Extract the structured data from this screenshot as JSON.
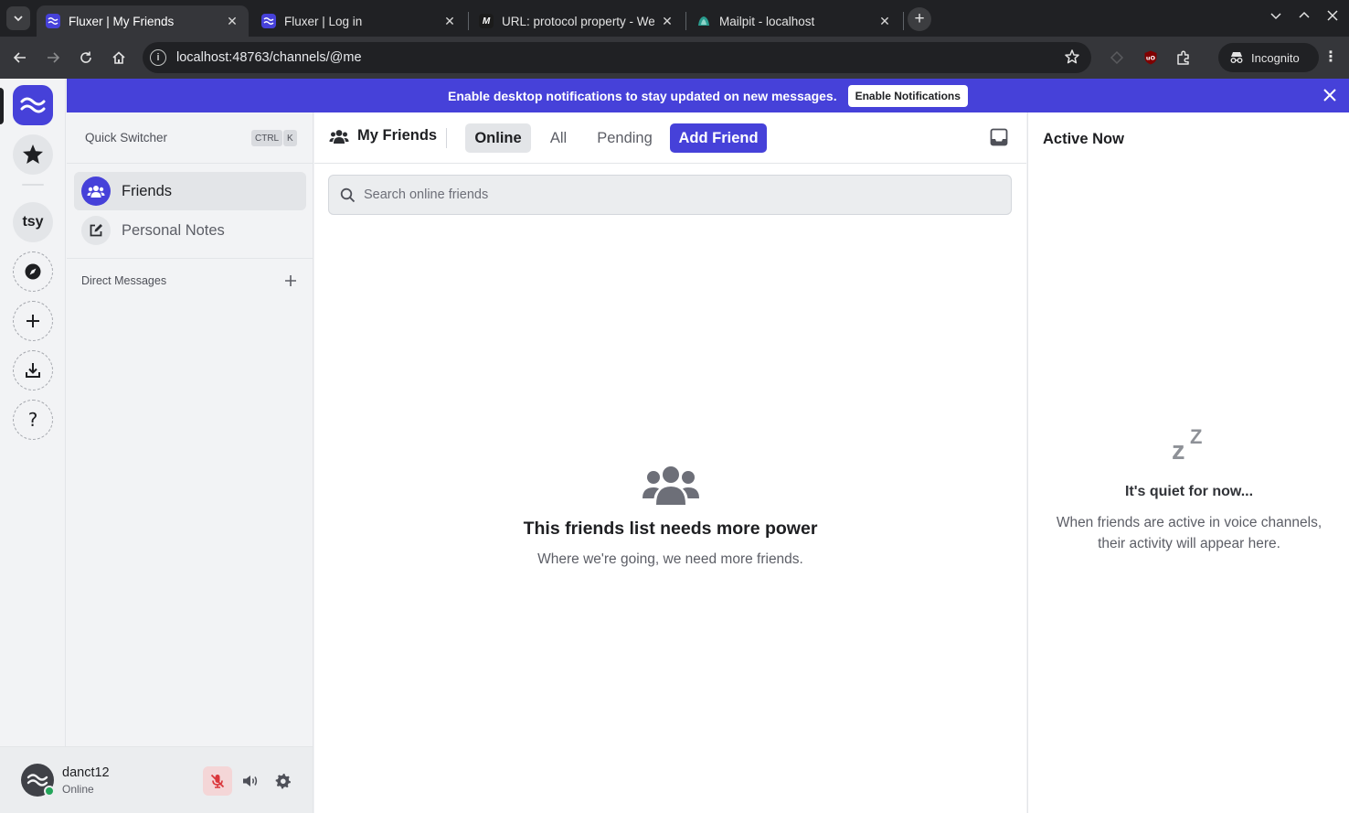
{
  "browser": {
    "tabs": [
      {
        "title": "Fluxer | My Friends",
        "active": true
      },
      {
        "title": "Fluxer | Log in",
        "active": false
      },
      {
        "title": "URL: protocol property - We",
        "active": false
      },
      {
        "title": "Mailpit - localhost",
        "active": false
      }
    ],
    "url": "localhost:48763/channels/@me",
    "incognito_label": "Incognito"
  },
  "notification_bar": {
    "message": "Enable desktop notifications to stay updated on new messages.",
    "button_label": "Enable Notifications"
  },
  "guild_rail": {
    "dm_server_label": "tsy"
  },
  "sidebar": {
    "quick_switcher": "Quick Switcher",
    "shortcut_keys": [
      "CTRL",
      "K"
    ],
    "nav_items": [
      {
        "label": "Friends",
        "selected": true
      },
      {
        "label": "Personal Notes",
        "selected": false
      }
    ],
    "direct_messages_label": "Direct Messages"
  },
  "user_panel": {
    "username": "danct12",
    "status": "Online"
  },
  "main": {
    "title": "My Friends",
    "tabs": [
      {
        "label": "Online",
        "selected": true
      },
      {
        "label": "All",
        "selected": false
      },
      {
        "label": "Pending",
        "selected": false
      },
      {
        "label": "Add Friend",
        "primary": true
      }
    ],
    "search_placeholder": "Search online friends",
    "empty_title": "This friends list needs more power",
    "empty_subtitle": "Where we're going, we need more friends."
  },
  "active_now": {
    "title": "Active Now",
    "empty_title": "It's quiet for now...",
    "empty_subtitle": "When friends are active in voice channels, their activity will appear here."
  },
  "colors": {
    "brand": "#4641d9",
    "online": "#23a55a",
    "muted_bg": "#f4d6d7",
    "muted_icon": "#da373c"
  },
  "icons": [
    "wave-logo-icon",
    "star-icon",
    "compass-icon",
    "plus-icon",
    "download-icon",
    "help-icon",
    "friends-icon",
    "edit-note-icon",
    "inbox-icon",
    "search-icon",
    "mic-muted-icon",
    "speaker-icon",
    "gear-icon",
    "close-icon",
    "sleep-zz-icon"
  ]
}
